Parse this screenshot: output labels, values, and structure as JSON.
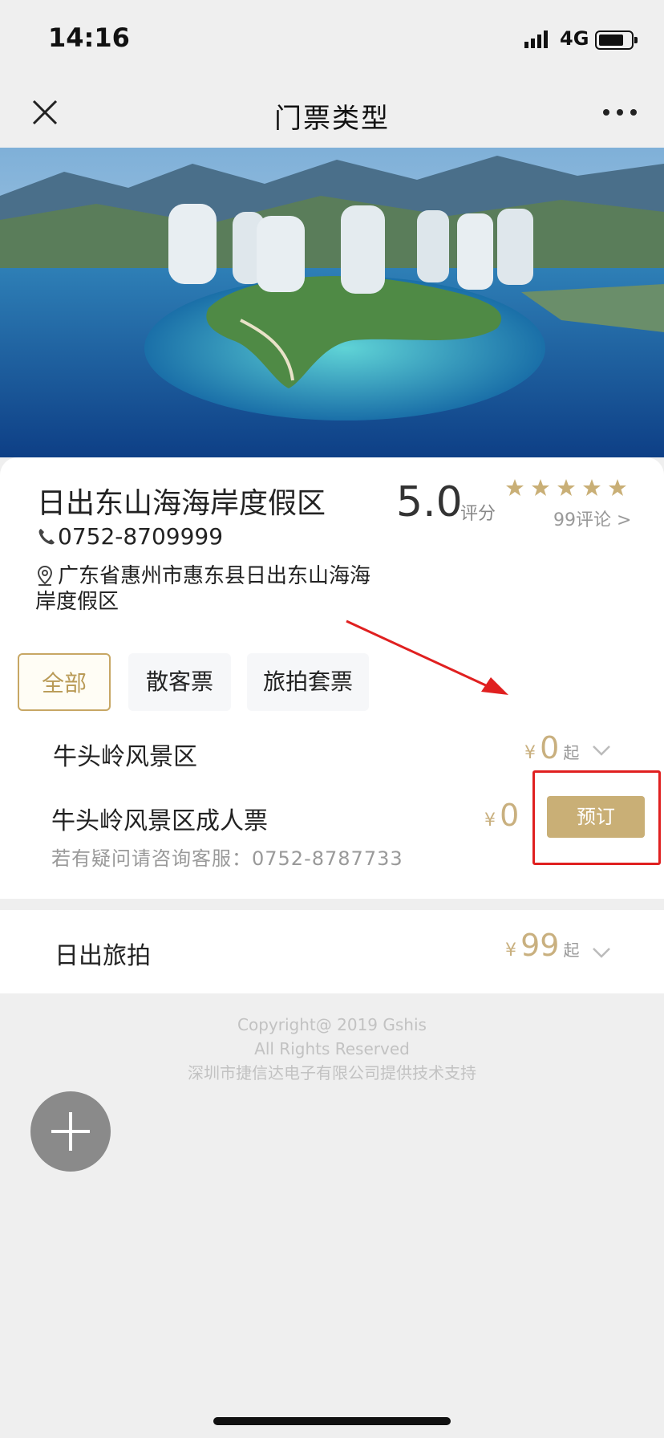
{
  "status_bar": {
    "time": "14:16",
    "network": "4G"
  },
  "nav": {
    "title": "门票类型",
    "close_icon": "close-icon",
    "more_icon": "more-horizontal-icon"
  },
  "resort": {
    "name": "日出东山海海岸度假区",
    "phone": "0752-8709999",
    "address": "广东省惠州市惠东县日出东山海海岸度假区",
    "score": "5.0",
    "score_unit": "评分",
    "stars": 5,
    "reviews": "99评论 >"
  },
  "tabs": [
    {
      "label": "全部",
      "active": true
    },
    {
      "label": "散客票",
      "active": false
    },
    {
      "label": "旅拍套票",
      "active": false
    }
  ],
  "ticket_group": {
    "name": "牛头岭风景区",
    "currency": "¥",
    "price": "0",
    "suffix": "起"
  },
  "ticket_item": {
    "name": "牛头岭风景区成人票",
    "currency": "¥",
    "price": "0",
    "book_label": "预订",
    "help_text": "若有疑问请咨询客服：0752-8787733"
  },
  "section2": {
    "name": "日出旅拍",
    "currency": "¥",
    "price": "99",
    "suffix": "起"
  },
  "footer": {
    "line1": "Copyright@ 2019 Gshis",
    "line2": "All Rights Reserved",
    "line3": "深圳市捷信达电子有限公司提供技术支持"
  },
  "colors": {
    "accent": "#c9af76",
    "highlight": "#e02020"
  }
}
